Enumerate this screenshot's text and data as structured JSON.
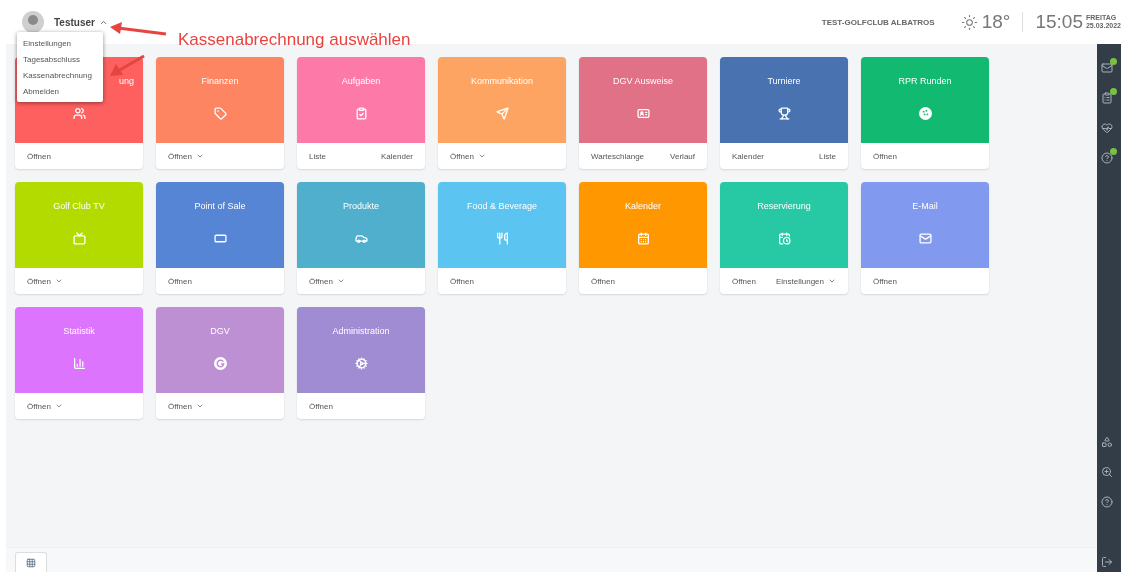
{
  "header": {
    "user": {
      "name": "Testuser",
      "expanded": true
    },
    "club": "TEST-GOLFCLUB ALBATROS",
    "temperature": "18°",
    "time": "15:05",
    "weekday": "FREITAG",
    "date": "25.03.2022"
  },
  "user_menu": [
    "Einstellungen",
    "Tagesabschluss",
    "Kassenabrechnung",
    "Abmelden"
  ],
  "annotation": {
    "text": "Kassenabrechnung auswählen"
  },
  "tiles": [
    {
      "title": "ung",
      "title_clipped": true,
      "color": "#fe5f5f",
      "actions": [
        {
          "label": "Öffnen",
          "dropdown": false
        }
      ]
    },
    {
      "title": "Finanzen",
      "color": "#fd8562",
      "actions": [
        {
          "label": "Öffnen",
          "dropdown": true
        }
      ]
    },
    {
      "title": "Aufgaben",
      "color": "#fd79a8",
      "actions": [
        {
          "label": "Liste",
          "dropdown": false
        },
        {
          "label": "Kalender",
          "dropdown": false
        }
      ]
    },
    {
      "title": "Kommunikation",
      "color": "#fda462",
      "actions": [
        {
          "label": "Öffnen",
          "dropdown": true
        }
      ]
    },
    {
      "title": "DGV Ausweise",
      "color": "#e07187",
      "actions": [
        {
          "label": "Warteschlange",
          "dropdown": false
        },
        {
          "label": "Verlauf",
          "dropdown": false
        }
      ]
    },
    {
      "title": "Turniere",
      "color": "#4872b0",
      "actions": [
        {
          "label": "Kalender",
          "dropdown": false
        },
        {
          "label": "Liste",
          "dropdown": false
        }
      ]
    },
    {
      "title": "RPR Runden",
      "color": "#12b970",
      "actions": [
        {
          "label": "Öffnen",
          "dropdown": false
        }
      ]
    },
    {
      "title": "Golf Club TV",
      "color": "#b4db00",
      "actions": [
        {
          "label": "Öffnen",
          "dropdown": true
        }
      ]
    },
    {
      "title": "Point of Sale",
      "color": "#5585d4",
      "actions": [
        {
          "label": "Öffnen",
          "dropdown": false
        }
      ]
    },
    {
      "title": "Produkte",
      "color": "#50afcc",
      "actions": [
        {
          "label": "Öffnen",
          "dropdown": true
        }
      ]
    },
    {
      "title": "Food & Beverage",
      "color": "#5bc4f1",
      "actions": [
        {
          "label": "Öffnen",
          "dropdown": false
        }
      ]
    },
    {
      "title": "Kalender",
      "color": "#ff9800",
      "actions": [
        {
          "label": "Öffnen",
          "dropdown": false
        }
      ]
    },
    {
      "title": "Reservierung",
      "color": "#26c9a4",
      "actions": [
        {
          "label": "Öffnen",
          "dropdown": false
        },
        {
          "label": "Einstellungen",
          "dropdown": true
        }
      ]
    },
    {
      "title": "E-Mail",
      "color": "#8199ee",
      "actions": [
        {
          "label": "Öffnen",
          "dropdown": false
        }
      ]
    },
    {
      "title": "Statistik",
      "color": "#dc74fd",
      "actions": [
        {
          "label": "Öffnen",
          "dropdown": true
        }
      ]
    },
    {
      "title": "DGV",
      "color": "#bd8fd3",
      "actions": [
        {
          "label": "Öffnen",
          "dropdown": true
        }
      ]
    },
    {
      "title": "Administration",
      "color": "#a08cd3",
      "actions": [
        {
          "label": "Öffnen",
          "dropdown": false
        }
      ]
    }
  ]
}
